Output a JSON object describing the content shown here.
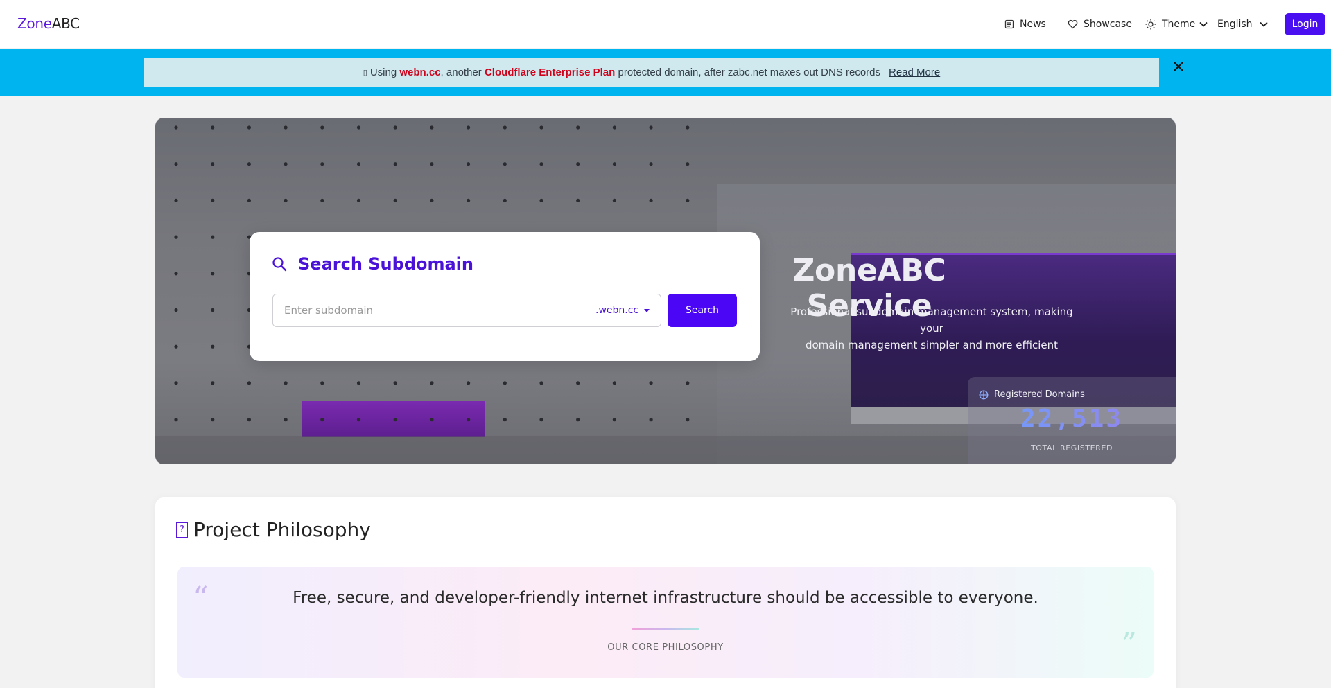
{
  "header": {
    "logo_zone": "Zone",
    "logo_abc": "ABC",
    "nav": {
      "news": "News",
      "showcase": "Showcase",
      "theme": "Theme",
      "language": "English"
    },
    "login": "Login"
  },
  "banner": {
    "icon": "▯",
    "text_1": "Using ",
    "highlight_domain": "webn.cc",
    "text_2": ", another ",
    "highlight_plan": "Cloudflare Enterprise Plan",
    "text_3": " protected domain, after zabc.net maxes out DNS records",
    "read_more": "Read More"
  },
  "search": {
    "title": "Search Subdomain",
    "placeholder": "Enter subdomain",
    "selected_domain": ".webn.cc",
    "button": "Search"
  },
  "hero": {
    "title": "ZoneABC Service",
    "subtitle_1": "Professional subdomain management system, making your",
    "subtitle_2": "domain management simpler and more efficient"
  },
  "stats": {
    "label": "Registered Domains",
    "count": "22,513",
    "caption": "TOTAL REGISTERED"
  },
  "philosophy": {
    "icon": "?",
    "title": "Project Philosophy",
    "quote": "Free, secure, and developer-friendly internet infrastructure should be accessible to everyone.",
    "caption": "OUR CORE PHILOSOPHY",
    "open_mark": "“",
    "close_mark": "”"
  },
  "colors": {
    "brand": "#4a0ff0",
    "banner": "#00b4f0",
    "highlight": "#d0021b"
  }
}
